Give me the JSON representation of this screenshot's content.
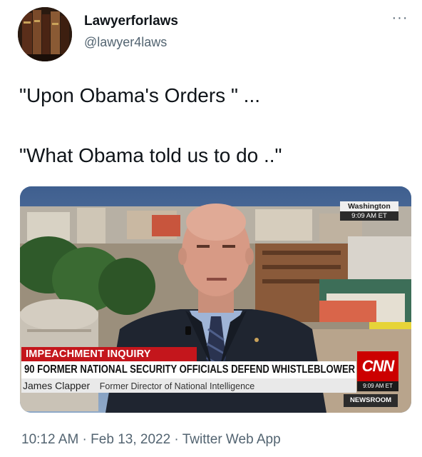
{
  "author": {
    "display_name": "Lawyerforlaws",
    "handle": "@lawyer4laws",
    "avatar_icon": "bookshelf-avatar-icon"
  },
  "more_label": "···",
  "tweet": {
    "lines": [
      "\"Upon Obama's Orders \" ...",
      "\"What Obama told us to do ..\""
    ]
  },
  "media": {
    "dateline_city": "Washington",
    "dateline_time": "9:09 AM ET",
    "chyron_tag": "IMPEACHMENT INQUIRY",
    "chyron_headline": "90 FORMER NATIONAL SECURITY OFFICIALS DEFEND WHISTLEBLOWER",
    "chyron_name": "James Clapper",
    "chyron_title": "Former Director of National Intelligence",
    "network_logo": "CNN",
    "network_time": "9:09 AM ET",
    "show_name": "NEWSROOM"
  },
  "meta": {
    "time": "10:12 AM",
    "date": "Feb 13, 2022",
    "source": "Twitter Web App",
    "separator": " · "
  },
  "colors": {
    "text": "#0f1419",
    "secondary": "#536471",
    "cnn_red": "#cc0000"
  }
}
